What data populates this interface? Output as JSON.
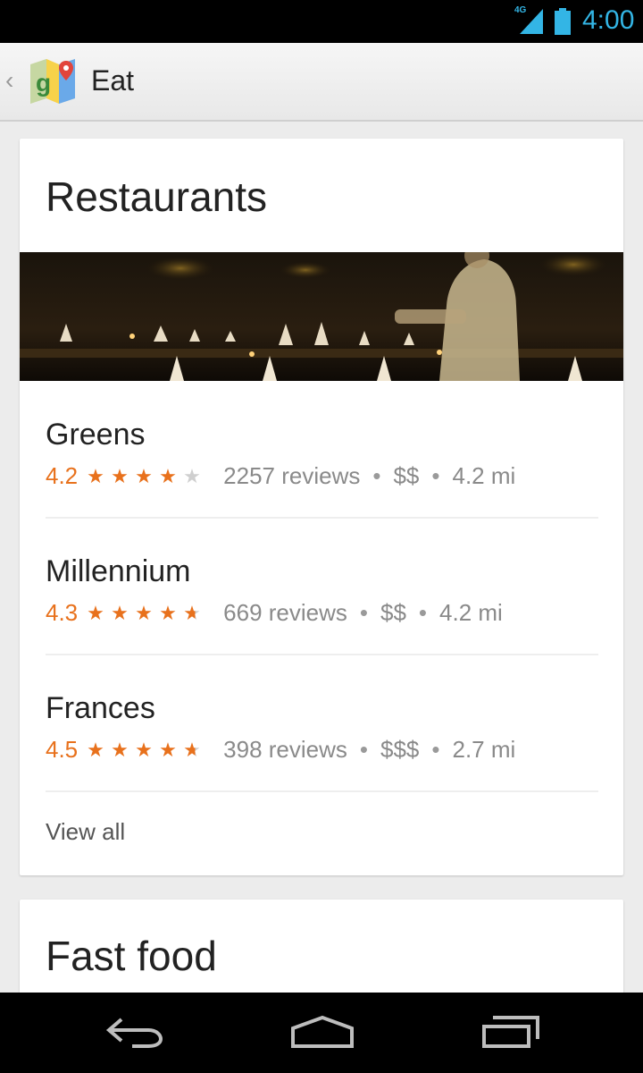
{
  "status_bar": {
    "network": "4G",
    "time": "4:00",
    "signal_icon": "signal-icon",
    "battery_icon": "battery-icon"
  },
  "action_bar": {
    "back_icon": "chevron-left-icon",
    "logo_icon": "google-maps-icon",
    "title": "Eat"
  },
  "sections": [
    {
      "title": "Restaurants",
      "items": [
        {
          "name": "Greens",
          "rating": "4.2",
          "stars": [
            1,
            1,
            1,
            1,
            0
          ],
          "reviews": "2257 reviews",
          "price": "$$",
          "distance": "4.2 mi"
        },
        {
          "name": "Millennium",
          "rating": "4.3",
          "stars": [
            1,
            1,
            1,
            1,
            0.5
          ],
          "reviews": "669 reviews",
          "price": "$$",
          "distance": "4.2 mi"
        },
        {
          "name": "Frances",
          "rating": "4.5",
          "stars": [
            1,
            1,
            1,
            1,
            0.5
          ],
          "reviews": "398 reviews",
          "price": "$$$",
          "distance": "2.7 mi"
        }
      ],
      "view_all": "View all"
    },
    {
      "title": "Fast food"
    }
  ],
  "separator": "•",
  "nav_bar": {
    "back_icon": "back-arrow-icon",
    "home_icon": "home-icon",
    "recents_icon": "recent-apps-icon"
  },
  "colors": {
    "accent_orange": "#e8711c",
    "status_blue": "#33b5e5",
    "star_empty": "#cfcfcf"
  }
}
